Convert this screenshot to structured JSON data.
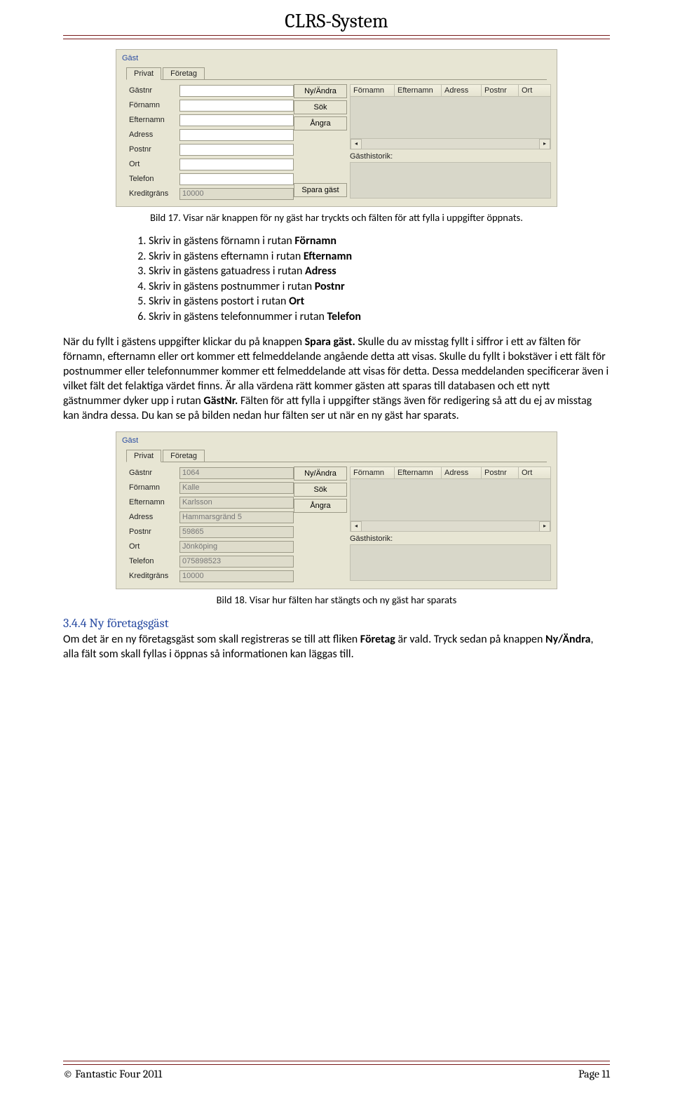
{
  "header": {
    "title": "CLRS-System"
  },
  "shot1": {
    "group_label": "Gäst",
    "tabs": {
      "privat": "Privat",
      "foretag": "Företag"
    },
    "labels": {
      "gastnr": "Gästnr",
      "fornamn": "Förnamn",
      "efternamn": "Efternamn",
      "adress": "Adress",
      "postnr": "Postnr",
      "ort": "Ort",
      "telefon": "Telefon",
      "kredit": "Kreditgräns"
    },
    "values": {
      "gastnr": "",
      "fornamn": "",
      "efternamn": "",
      "adress": "",
      "postnr": "",
      "ort": "",
      "telefon": "",
      "kredit": "10000"
    },
    "buttons": {
      "ny": "Ny/Ändra",
      "sok": "Sök",
      "angra": "Ångra",
      "spara": "Spara gäst"
    },
    "grid_headers": [
      "Förnamn",
      "Efternamn",
      "Adress",
      "Postnr",
      "Ort"
    ],
    "historik_label": "Gästhistorik:"
  },
  "caption1": "Bild 17. Visar när knappen för ny gäst har tryckts och fälten för att fylla i uppgifter öppnats.",
  "steps": [
    {
      "pre": "Skriv in gästens förnamn i rutan ",
      "bold": "Förnamn"
    },
    {
      "pre": "Skriv in gästens efternamn i rutan ",
      "bold": "Efternamn"
    },
    {
      "pre": "Skriv in gästens gatuadress i rutan ",
      "bold": "Adress"
    },
    {
      "pre": "Skriv in gästens postnummer i rutan ",
      "bold": "Postnr"
    },
    {
      "pre": "Skriv in gästens postort i rutan ",
      "bold": "Ort"
    },
    {
      "pre": "Skriv in gästens telefonnummer i rutan ",
      "bold": "Telefon"
    }
  ],
  "body1_a": "När du fyllt i gästens uppgifter klickar du på knappen ",
  "body1_b": "Spara gäst.",
  "body1_c": " Skulle du av misstag fyllt i siffror i ett av fälten för förnamn, efternamn eller ort kommer ett felmeddelande angående detta att visas. Skulle du fyllt i bokstäver i ett fält för postnummer eller telefonnummer kommer ett felmeddelande att visas för detta. Dessa meddelanden specificerar även i vilket fält det felaktiga värdet finns. Är alla värdena rätt kommer gästen att sparas till databasen och ett nytt gästnummer dyker upp i rutan ",
  "body1_d": "GästNr.",
  "body1_e": " Fälten för att fylla i uppgifter stängs även för redigering så att du ej av misstag kan ändra dessa. Du kan se på bilden nedan hur fälten ser ut när en ny gäst har sparats.",
  "shot2": {
    "group_label": "Gäst",
    "tabs": {
      "privat": "Privat",
      "foretag": "Företag"
    },
    "labels": {
      "gastnr": "Gästnr",
      "fornamn": "Förnamn",
      "efternamn": "Efternamn",
      "adress": "Adress",
      "postnr": "Postnr",
      "ort": "Ort",
      "telefon": "Telefon",
      "kredit": "Kreditgräns"
    },
    "values": {
      "gastnr": "1064",
      "fornamn": "Kalle",
      "efternamn": "Karlsson",
      "adress": "Hammarsgränd 5",
      "postnr": "59865",
      "ort": "Jönköping",
      "telefon": "075898523",
      "kredit": "10000"
    },
    "buttons": {
      "ny": "Ny/Ändra",
      "sok": "Sök",
      "angra": "Ångra"
    },
    "grid_headers": [
      "Förnamn",
      "Efternamn",
      "Adress",
      "Postnr",
      "Ort"
    ],
    "historik_label": "Gästhistorik:"
  },
  "caption2": "Bild 18. Visar hur fälten har stängts och ny gäst har sparats",
  "section_heading": "3.4.4 Ny företagsgäst",
  "body2_a": "Om det är en ny företagsgäst som skall registreras se till att fliken ",
  "body2_b": "Företag",
  "body2_c": " är vald. Tryck sedan på knappen ",
  "body2_d": "Ny/Ändra",
  "body2_e": ", alla fält som skall fyllas i öppnas så informationen kan läggas till.",
  "footer": {
    "left": "© Fantastic Four 2011",
    "right": "Page 11"
  }
}
